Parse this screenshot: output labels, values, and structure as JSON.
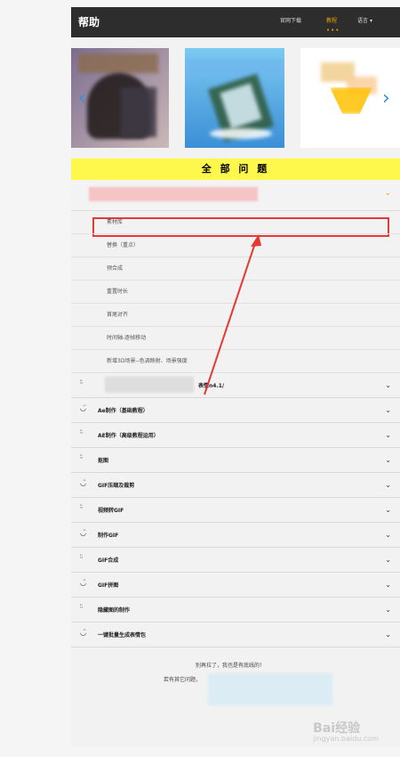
{
  "header": {
    "title": "帮助",
    "nav": [
      "官网下载",
      "教程",
      "语言"
    ],
    "active_nav": "教程",
    "language_arrow": "▾"
  },
  "carousel": {
    "prev_icon": "‹",
    "next_icon": "›"
  },
  "main": {
    "section_title": "全 部 问 题",
    "open_group_chevron": "⌄",
    "subitems": [
      "素材库",
      "替换（重点）",
      "预合成",
      "重置时长",
      "首尾对齐",
      "时间轴-逐帧移动",
      "新增3D场景--色调映射、场景强度"
    ],
    "items": [
      {
        "icon": "smiley-icon",
        "label": "表情n4.1/"
      },
      {
        "icon": "smiley-icon",
        "label": "Ae制作（基础教程）"
      },
      {
        "icon": "smiley-icon",
        "label": "AE制作（高级教程运用）"
      },
      {
        "icon": "smiley-icon",
        "label": "抠图"
      },
      {
        "icon": "smiley-icon",
        "label": "GIF压缩及裁剪"
      },
      {
        "icon": "smiley-icon",
        "label": "视频转GIF"
      },
      {
        "icon": "smiley-icon",
        "label": "制作GIF"
      },
      {
        "icon": "smiley-icon",
        "label": "GIF合成"
      },
      {
        "icon": "smiley-icon",
        "label": "GIF拼图"
      },
      {
        "icon": "smiley-icon",
        "label": "隐藏图的制作"
      },
      {
        "icon": "smiley-icon",
        "label": "一键批量生成表情包"
      }
    ]
  },
  "footer": {
    "line1": "别再拉了，我也是有底线的！",
    "line2": "若有其它问题，"
  },
  "watermark": {
    "brand": "Bai经验",
    "sub": "jingyan.baidu.com"
  },
  "colors": {
    "accent_yellow": "#fff84c",
    "highlight_red": "#e53935",
    "active_orange": "#f2a000",
    "topbar_dark": "#2d2d2d"
  }
}
